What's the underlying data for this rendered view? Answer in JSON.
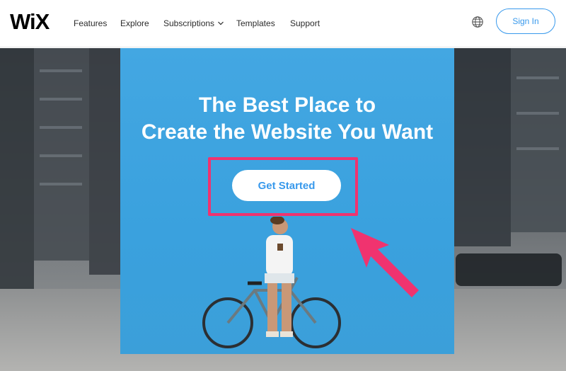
{
  "brand": {
    "logo_text": "WiX"
  },
  "nav": {
    "features": "Features",
    "explore": "Explore",
    "subscriptions": "Subscriptions",
    "templates": "Templates",
    "support": "Support"
  },
  "header": {
    "signin_label": "Sign In"
  },
  "hero": {
    "title_line1": "The Best Place to",
    "title_line2": "Create the Website You Want",
    "cta_label": "Get Started"
  },
  "colors": {
    "accent": "#3899ec",
    "highlight": "#f0336f",
    "hero_background": "#3ea3df"
  },
  "icons": {
    "language": "globe-icon",
    "dropdown": "chevron-down-icon",
    "annotation": "arrow-icon"
  }
}
